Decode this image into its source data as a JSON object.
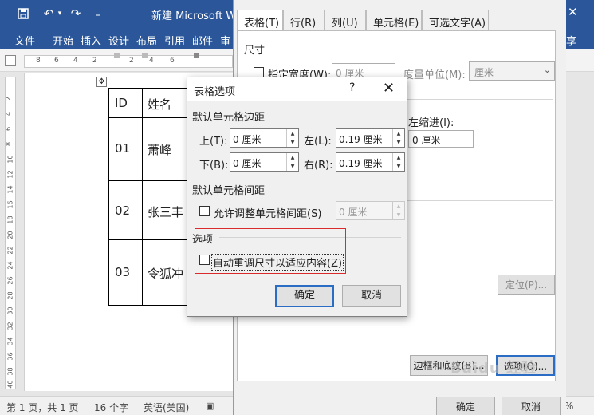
{
  "word": {
    "title": "新建 Microsoft W",
    "qat": {
      "save_icon": "save-icon",
      "undo_icon": "undo-icon",
      "redo_icon": "redo-icon",
      "customize_icon": "chevron-down-icon"
    },
    "ribbon_tabs": [
      "文件",
      "开始",
      "插入",
      "设计",
      "布局",
      "引用",
      "邮件",
      "审"
    ],
    "share": "享",
    "hruler_ticks": [
      "8",
      "6",
      "4",
      "2",
      "2",
      "4",
      "6"
    ],
    "vruler_ticks": [
      "2",
      "4",
      "6",
      "8",
      "10",
      "12",
      "14",
      "16",
      "18",
      "20",
      "22",
      "24",
      "26",
      "28",
      "30",
      "32",
      "34",
      "36",
      "38",
      "40"
    ]
  },
  "doc_table": {
    "headers": [
      "ID",
      "姓名"
    ],
    "rows": [
      {
        "id": "01",
        "name": "萧峰"
      },
      {
        "id": "02",
        "name": "张三丰"
      },
      {
        "id": "03",
        "name": "令狐冲"
      }
    ]
  },
  "statusbar": {
    "pages": "第 1 页，共 1 页",
    "words": "16 个字",
    "language": "英语(美国)",
    "zoom": "%"
  },
  "table_props": {
    "tabs": [
      "表格(T)",
      "行(R)",
      "列(U)",
      "单元格(E)",
      "可选文字(A)"
    ],
    "active_tab": 0,
    "size_section": "尺寸",
    "preferred_width": "指定宽度(W):",
    "width_value": "0 厘米",
    "measure_label": "度量单位(M):",
    "measure_value": "厘米",
    "indent_label": "左缩进(I):",
    "indent_value": "0 厘米",
    "positioning_button": "定位(P)...",
    "borders_button": "边框和底纹(B)...",
    "options_button": "选项(O)...",
    "ok": "确定",
    "cancel": "取消"
  },
  "table_options": {
    "title": "表格选项",
    "help": "?",
    "margins_section": "默认单元格边距",
    "top_label": "上(T):",
    "top_value": "0 厘米",
    "left_label": "左(L):",
    "left_value": "0.19 厘米",
    "bottom_label": "下(B):",
    "bottom_value": "0 厘米",
    "right_label": "右(R):",
    "right_value": "0.19 厘米",
    "spacing_section": "默认单元格间距",
    "allow_spacing": "允许调整单元格间距(S)",
    "allow_spacing_checked": false,
    "spacing_value": "0 厘米",
    "options_section": "选项",
    "autoresize": "自动重调尺寸以适应内容(Z)",
    "autoresize_checked": false,
    "ok": "确定",
    "cancel": "取消",
    "highlight_color": "#d92b2b"
  },
  "watermark": "Baidu 经验"
}
